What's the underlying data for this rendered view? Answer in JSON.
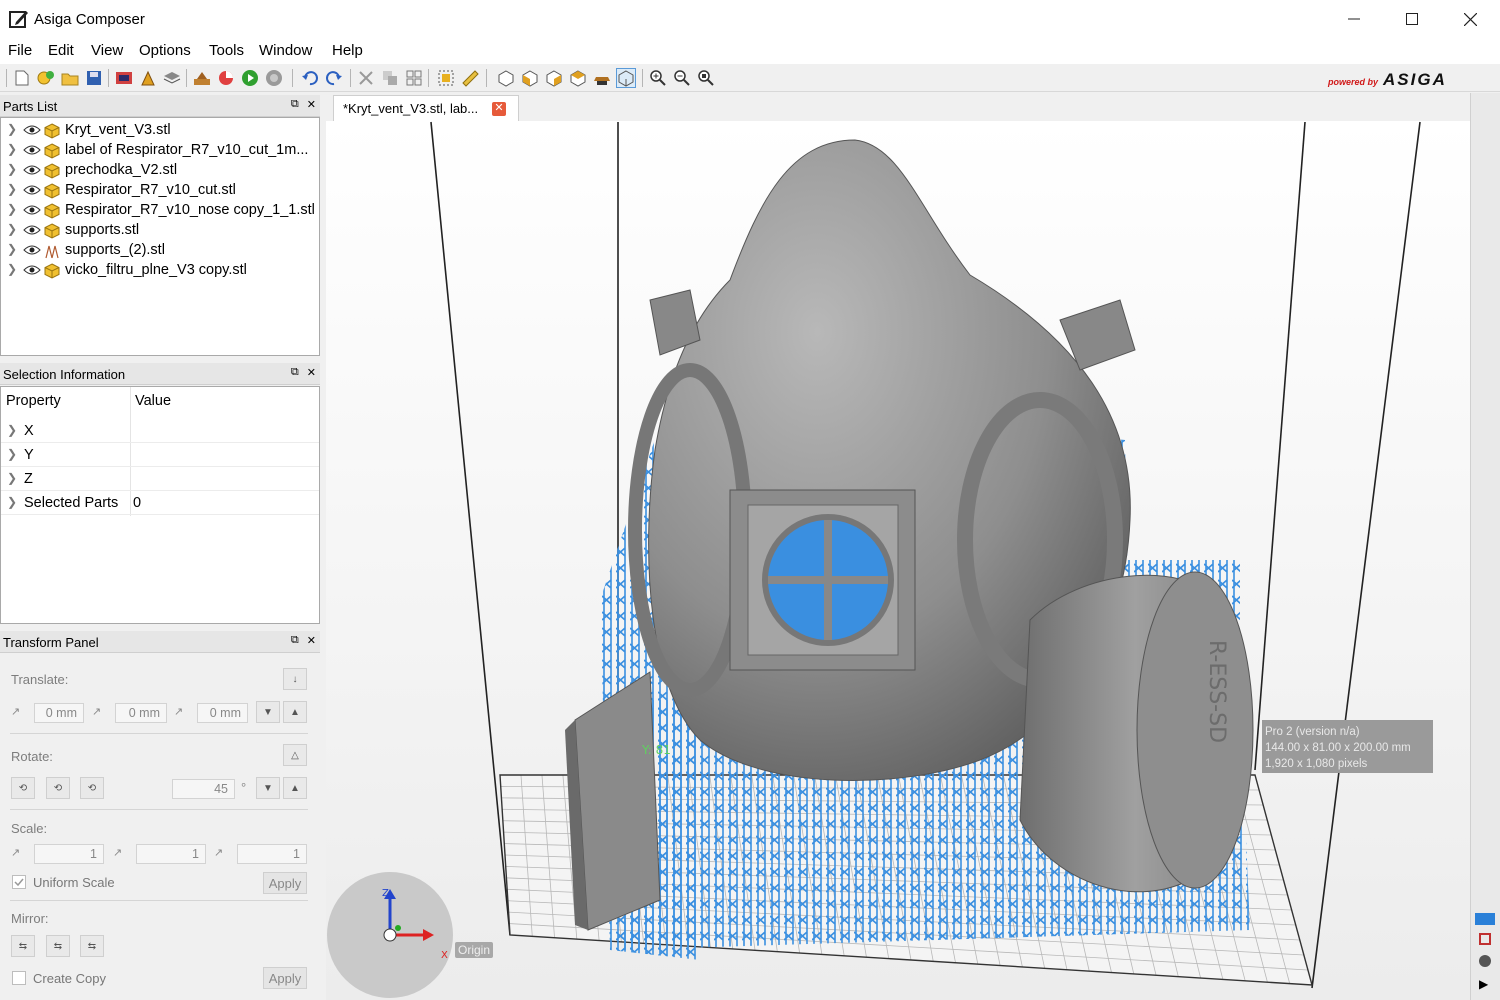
{
  "window": {
    "title": "Asiga Composer"
  },
  "menu": [
    "File",
    "Edit",
    "View",
    "Options",
    "Tools",
    "Window",
    "Help"
  ],
  "toolbar": {
    "powered_by": "powered by",
    "brand": "ASIGA"
  },
  "parts_list": {
    "title": "Parts List",
    "items": [
      {
        "name": "Kryt_vent_V3.stl",
        "kind": "mesh"
      },
      {
        "name": "label of Respirator_R7_v10_cut_1m...",
        "kind": "mesh"
      },
      {
        "name": "prechodka_V2.stl",
        "kind": "mesh"
      },
      {
        "name": "Respirator_R7_v10_cut.stl",
        "kind": "mesh"
      },
      {
        "name": "Respirator_R7_v10_nose copy_1_1.stl",
        "kind": "mesh"
      },
      {
        "name": "supports.stl",
        "kind": "mesh"
      },
      {
        "name": "supports_(2).stl",
        "kind": "supports"
      },
      {
        "name": "vicko_filtru_plne_V3 copy.stl",
        "kind": "mesh"
      }
    ]
  },
  "selection": {
    "title": "Selection Information",
    "col_property": "Property",
    "col_value": "Value",
    "rows": [
      {
        "key": "X",
        "value": ""
      },
      {
        "key": "Y",
        "value": ""
      },
      {
        "key": "Z",
        "value": ""
      },
      {
        "key": "Selected Parts",
        "value": "0"
      }
    ]
  },
  "transform": {
    "title": "Transform Panel",
    "translate_label": "Translate:",
    "tx": "0 mm",
    "ty": "0 mm",
    "tz": "0 mm",
    "rotate_label": "Rotate:",
    "angle": "45",
    "degree_sign": "°",
    "scale_label": "Scale:",
    "sx": "1",
    "sy": "1",
    "sz": "1",
    "uniform_scale": "Uniform Scale",
    "apply": "Apply",
    "mirror_label": "Mirror:",
    "create_copy": "Create Copy",
    "apply2": "Apply"
  },
  "document_tab": {
    "label": "*Kryt_vent_V3.stl, lab..."
  },
  "viewport": {
    "printer_line1": "Pro 2 (version n/a)",
    "printer_line2": "144.00 x 81.00 x 200.00 mm",
    "printer_line3": "1,920 x 1,080 pixels",
    "origin": "Origin",
    "part_tag": "Y: 81",
    "axis_z": "Z",
    "axis_x": "X",
    "filter_text": "R-ESS-SD",
    "model_color": "#8f8f8f",
    "support_color": "#3a8fe0"
  }
}
